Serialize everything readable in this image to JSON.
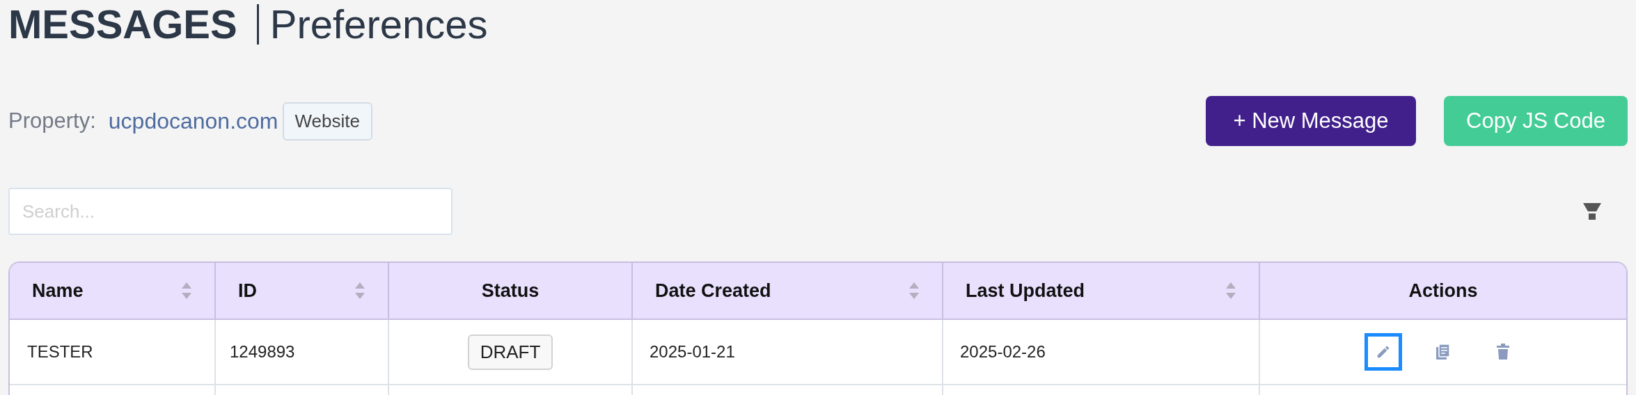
{
  "header": {
    "title": "MESSAGES",
    "subtitle": "Preferences"
  },
  "property": {
    "label": "Property:",
    "value": "ucpdocanon.com",
    "badge": "Website"
  },
  "buttons": [
    {
      "kind": "primary",
      "label": "+ New Message"
    },
    {
      "kind": "secondary",
      "label": "Copy JS Code"
    }
  ],
  "search": {
    "placeholder": "Search..."
  },
  "table": {
    "columns": [
      {
        "label": "Name",
        "sortable": true
      },
      {
        "label": "ID",
        "sortable": true
      },
      {
        "label": "Status",
        "sortable": false
      },
      {
        "label": "Date Created",
        "sortable": true
      },
      {
        "label": "Last Updated",
        "sortable": true
      },
      {
        "label": "Actions",
        "sortable": false
      }
    ],
    "rows": [
      {
        "name": "TESTER",
        "id": "1249893",
        "status": "DRAFT",
        "date_created": "2025-01-21",
        "last_updated": "2025-02-26",
        "actions": [
          {
            "kind": "edit",
            "focused": true
          },
          {
            "kind": "copy",
            "focused": false
          },
          {
            "kind": "delete",
            "focused": false
          }
        ]
      }
    ]
  }
}
